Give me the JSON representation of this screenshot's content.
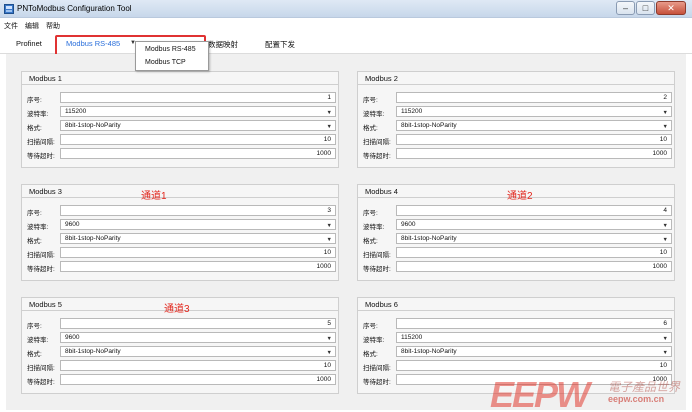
{
  "window": {
    "title": "PNToModbus Configuration Tool",
    "minimize": "–",
    "maximize": "□",
    "close": "✕"
  },
  "menu": {
    "items": [
      "文件",
      "编辑",
      "帮助"
    ]
  },
  "tabs": {
    "items": [
      "Profinet",
      "Modbus RS-485",
      "数据映射",
      "配置下发"
    ],
    "active": "Modbus RS-485",
    "arrow": "▼"
  },
  "dropdown": {
    "options": [
      "Modbus RS-485",
      "Modbus TCP"
    ]
  },
  "labels": {
    "seq": "序号:",
    "baud": "波特率:",
    "format": "格式:",
    "scan": "扫描间隔:",
    "timeout": "等待超时:"
  },
  "panels": [
    {
      "title": "Modbus 1",
      "channel": "",
      "seq": "1",
      "baud": "115200",
      "format": "8bit-1stop-NoParity",
      "scan": "10",
      "timeout": "1000"
    },
    {
      "title": "Modbus 2",
      "channel": "",
      "seq": "2",
      "baud": "115200",
      "format": "8bit-1stop-NoParity",
      "scan": "10",
      "timeout": "1000"
    },
    {
      "title": "Modbus 3",
      "channel": "通道1",
      "seq": "3",
      "baud": "9600",
      "format": "8bit-1stop-NoParity",
      "scan": "10",
      "timeout": "1000"
    },
    {
      "title": "Modbus 4",
      "channel": "通道2",
      "seq": "4",
      "baud": "9600",
      "format": "8bit-1stop-NoParity",
      "scan": "10",
      "timeout": "1000"
    },
    {
      "title": "Modbus 5",
      "channel": "通道3",
      "seq": "5",
      "baud": "9600",
      "format": "8bit-1stop-NoParity",
      "scan": "10",
      "timeout": "1000"
    },
    {
      "title": "Modbus 6",
      "channel": "",
      "seq": "6",
      "baud": "115200",
      "format": "8bit-1stop-NoParity",
      "scan": "10",
      "timeout": "1000"
    }
  ],
  "watermark": {
    "logo": "EEPW",
    "cn": "電子產品世界",
    "url": "eepw.com.cn"
  },
  "colors": {
    "accent": "#2a6fdb",
    "highlight": "#e03232",
    "channel_text": "#e2261c"
  }
}
